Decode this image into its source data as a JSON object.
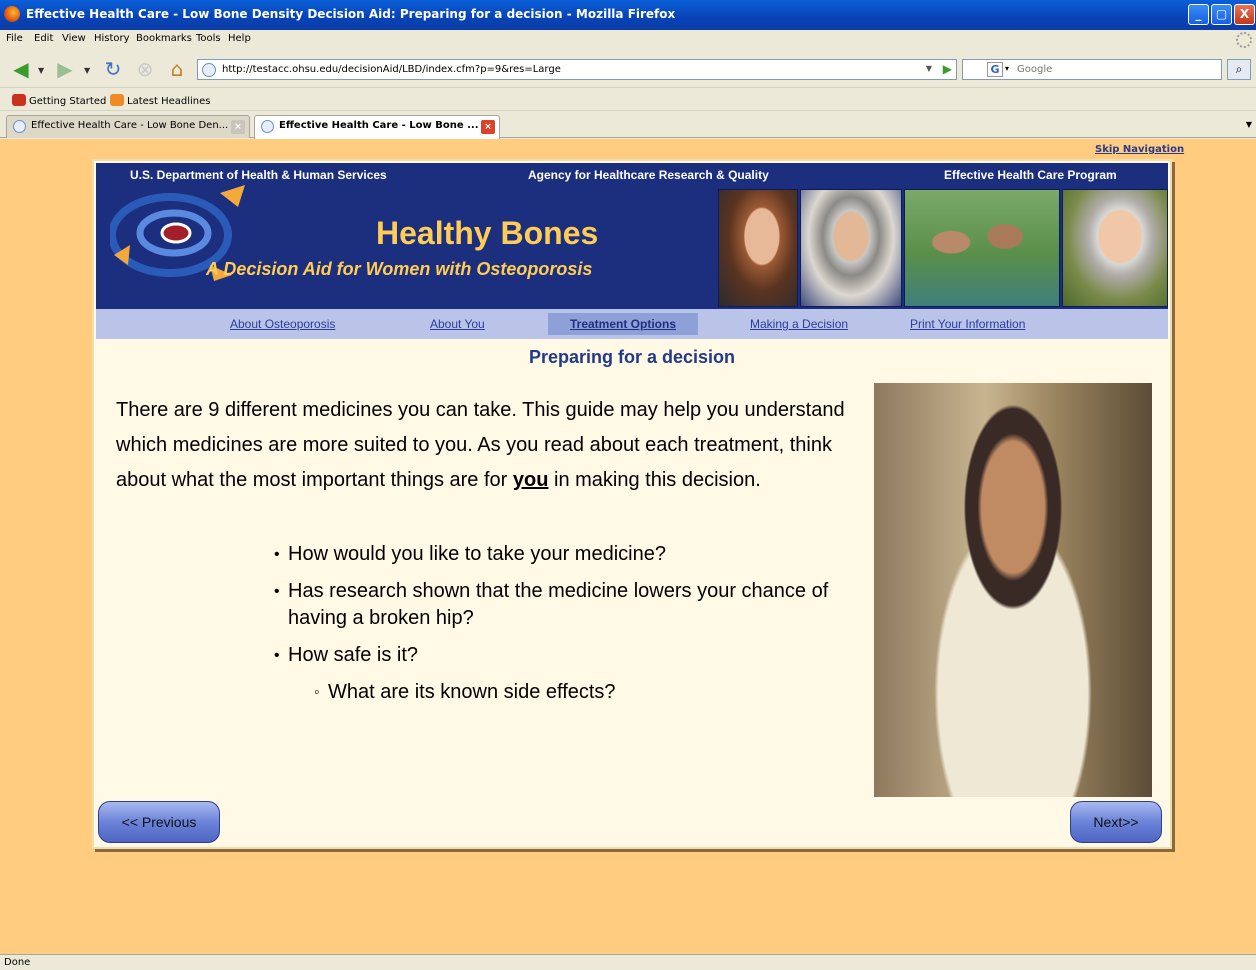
{
  "window": {
    "title": "Effective Health Care - Low Bone Density Decision Aid: Preparing for a decision - Mozilla Firefox",
    "minimize": "_",
    "maximize": "▢",
    "close": "X"
  },
  "menubar": [
    "File",
    "Edit",
    "View",
    "History",
    "Bookmarks",
    "Tools",
    "Help"
  ],
  "navbar": {
    "url": "http://testacc.ohsu.edu/decisionAid/LBD/index.cfm?p=9&res=Large",
    "search_placeholder": "Google",
    "search_engine_icon": "G"
  },
  "bookmarks": [
    "Getting Started",
    "Latest Headlines"
  ],
  "tabs": [
    {
      "label": "Effective Health Care - Low Bone Den..."
    },
    {
      "label": "Effective Health Care - Low Bone ..."
    }
  ],
  "page": {
    "skip_nav": "Skip Navigation",
    "banner": {
      "left": "U.S. Department of Health & Human Services",
      "center": "Agency for Healthcare Research & Quality",
      "right": "Effective Health Care Program",
      "title": "Healthy Bones",
      "subtitle": "A Decision Aid for Women with Osteoporosis"
    },
    "menu": [
      "About Osteoporosis",
      "About You",
      "Treatment Options",
      "Making a Decision",
      "Print Your Information"
    ],
    "heading": "Preparing for a decision",
    "intro_before": "There are 9 different medicines you can take. This guide may help you understand which medicines are more suited to you. As you read about each treatment, think about what the most important things are for ",
    "intro_emph": "you",
    "intro_after": " in making this decision.",
    "bullets": [
      "How would you like to take your medicine?",
      "Has research shown that the medicine lowers your chance of having a broken hip?",
      "How safe is it?"
    ],
    "sub_bullets": [
      "What are its known side effects?"
    ],
    "prev_button": "<< Previous",
    "next_button": "Next>>"
  },
  "status": "Done",
  "colors": {
    "page_bg": "#ffcc80",
    "banner_bg": "#1b2f7e",
    "banner_title": "#ffcc55",
    "menu_bg": "#b9c4e8",
    "heading": "#223a8a"
  }
}
